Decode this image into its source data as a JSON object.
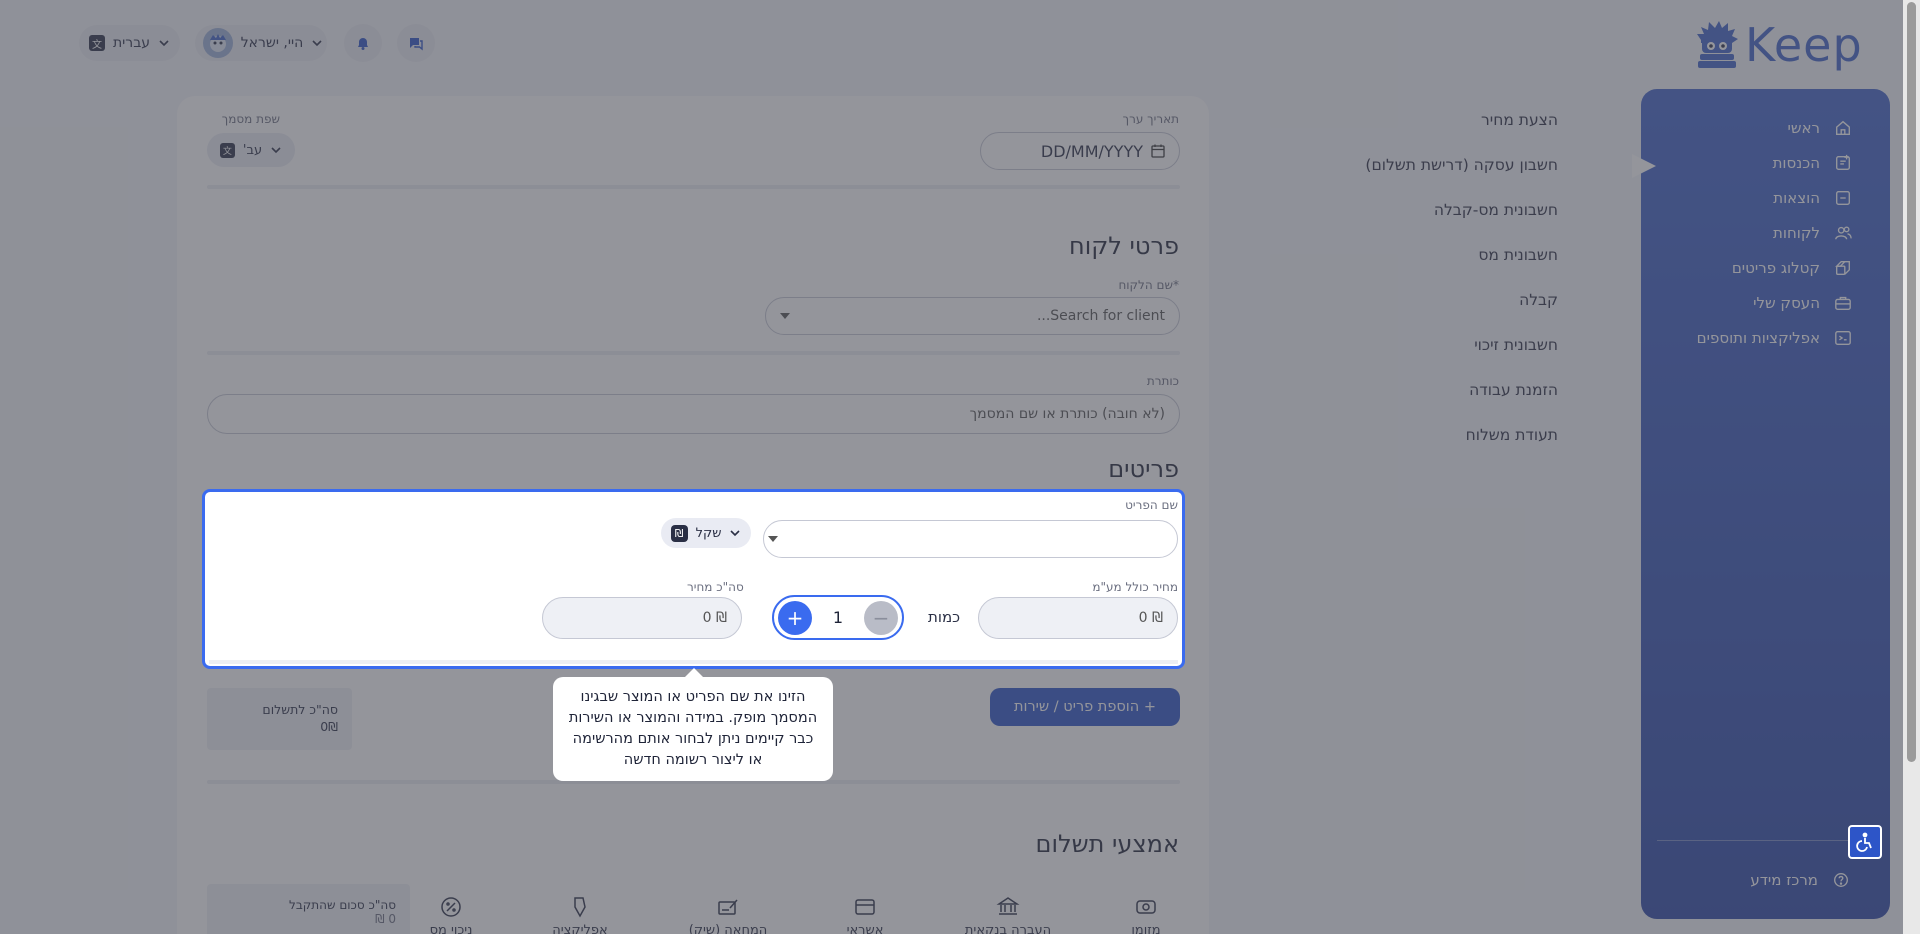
{
  "brand": {
    "name": "Keep"
  },
  "sidebar": {
    "items": [
      {
        "label": "ראשי",
        "icon": "home-icon"
      },
      {
        "label": "הכנסות",
        "icon": "income-doc-icon"
      },
      {
        "label": "הוצאות",
        "icon": "expenses-icon"
      },
      {
        "label": "לקוחות",
        "icon": "clients-icon"
      },
      {
        "label": "קטלוג פריטים",
        "icon": "catalog-icon"
      },
      {
        "label": "העסק שלי",
        "icon": "briefcase-icon"
      },
      {
        "label": "אפליקציות ותוספים",
        "icon": "apps-icon"
      }
    ],
    "help": "מרכז מידע"
  },
  "doc_types": [
    "הצעת מחיר",
    "חשבון עסקה (דרישת תשלום)",
    "חשבונית מס-קבלה",
    "חשבונית מס",
    "קבלה",
    "חשבונית זיכוי",
    "הזמנת עבודה",
    "תעודת משלוח"
  ],
  "topbar": {
    "language": "עברית",
    "user_greeting": "היי, ישראל"
  },
  "document": {
    "date_label": "תאריך ערך",
    "date_placeholder": "DD/MM/YYYY",
    "doc_lang_label": "שפת מסמך",
    "doc_lang_value": "עב'",
    "client_section_title": "פרטי לקוח",
    "client_name_label": "*שם הלקוח",
    "client_search_placeholder": "Search for client...",
    "title_label": "כותרת",
    "title_placeholder": "(לא חובה) כותרת או שם המסמך",
    "items_section_title": "פריטים"
  },
  "item_row": {
    "item_name_label": "שם הפריט",
    "currency_label": "שקל",
    "currency_symbol": "₪",
    "price_label": "מחיר כולל מע\"מ",
    "price_value": "₪ 0",
    "quantity_label": "כמות",
    "quantity_value": "1",
    "total_label": "סה\"כ מחיר",
    "total_value": "₪ 0"
  },
  "tooltip": {
    "text": "הזינו את שם הפריט או המוצר שבגינו המסמך מופק. במידה והמוצר או השירות כבר קיימים ניתן לבחור אותם מהרשימה או ליצור רשומה חדשה"
  },
  "add_item_button": "+ הוספת פריט / שירות",
  "total_to_pay": {
    "label": "סה\"כ לתשלום",
    "value": "0₪"
  },
  "payments": {
    "title": "אמצעי תשלום",
    "methods": [
      {
        "label": "מזומן",
        "icon": "cash-icon"
      },
      {
        "label": "העברה בנקאית",
        "icon": "bank-icon"
      },
      {
        "label": "אשראי",
        "icon": "credit-card-icon"
      },
      {
        "label": "המחאה (שיק)",
        "icon": "cheque-icon"
      },
      {
        "label": "אפליקציה",
        "icon": "app-payment-icon"
      },
      {
        "label": "ניכוי מס",
        "icon": "tax-deduction-icon"
      }
    ],
    "received_label": "סה\"כ סכום שהתקבל",
    "received_value": "0 ₪"
  },
  "colors": {
    "accent": "#3a6bef",
    "sidebar": "#3357b8",
    "brand": "#3f62c8"
  }
}
